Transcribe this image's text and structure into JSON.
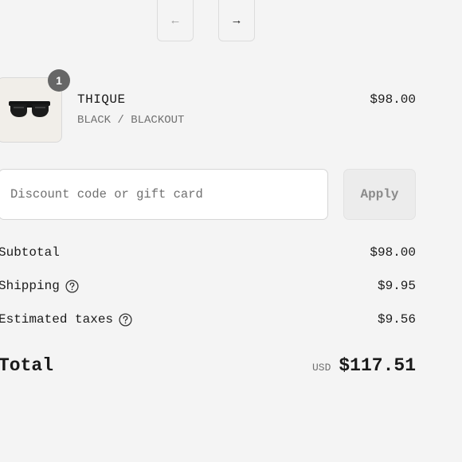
{
  "nav": {
    "prev_arrow": "←",
    "next_arrow": "→"
  },
  "line_item": {
    "quantity": "1",
    "name": "THIQUE",
    "variant": "BLACK / BLACKOUT",
    "price": "$98.00",
    "image_icon": "sunglasses-icon"
  },
  "discount": {
    "placeholder": "Discount code or gift card",
    "value": "",
    "apply_label": "Apply"
  },
  "summary": {
    "subtotal_label": "Subtotal",
    "subtotal_value": "$98.00",
    "shipping_label": "Shipping",
    "shipping_value": "$9.95",
    "taxes_label": "Estimated taxes",
    "taxes_value": "$9.56",
    "help_icon": "question-circle-icon"
  },
  "total": {
    "label": "Total",
    "currency": "USD",
    "value": "$117.51"
  }
}
